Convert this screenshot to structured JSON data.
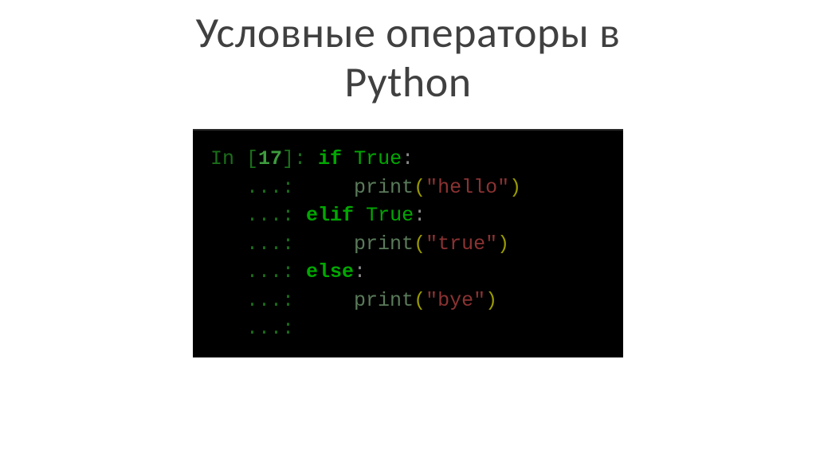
{
  "title_line1": "Условные операторы в",
  "title_line2": "Python",
  "code": {
    "prompt_label": "In [",
    "prompt_num": "17",
    "prompt_close": "]: ",
    "cont_prefix": "   ...: ",
    "line1": {
      "kw_if": "if",
      "kw_true": "True",
      "colon": ":"
    },
    "line2": {
      "func": "print",
      "open": "(",
      "str": "\"hello\"",
      "close": ")"
    },
    "line3": {
      "kw_elif": "elif",
      "kw_true": "True",
      "colon": ":"
    },
    "line4": {
      "func": "print",
      "open": "(",
      "str": "\"true\"",
      "close": ")"
    },
    "line5": {
      "kw_else": "else",
      "colon": ":"
    },
    "line6": {
      "func": "print",
      "open": "(",
      "str": "\"bye\"",
      "close": ")"
    }
  }
}
